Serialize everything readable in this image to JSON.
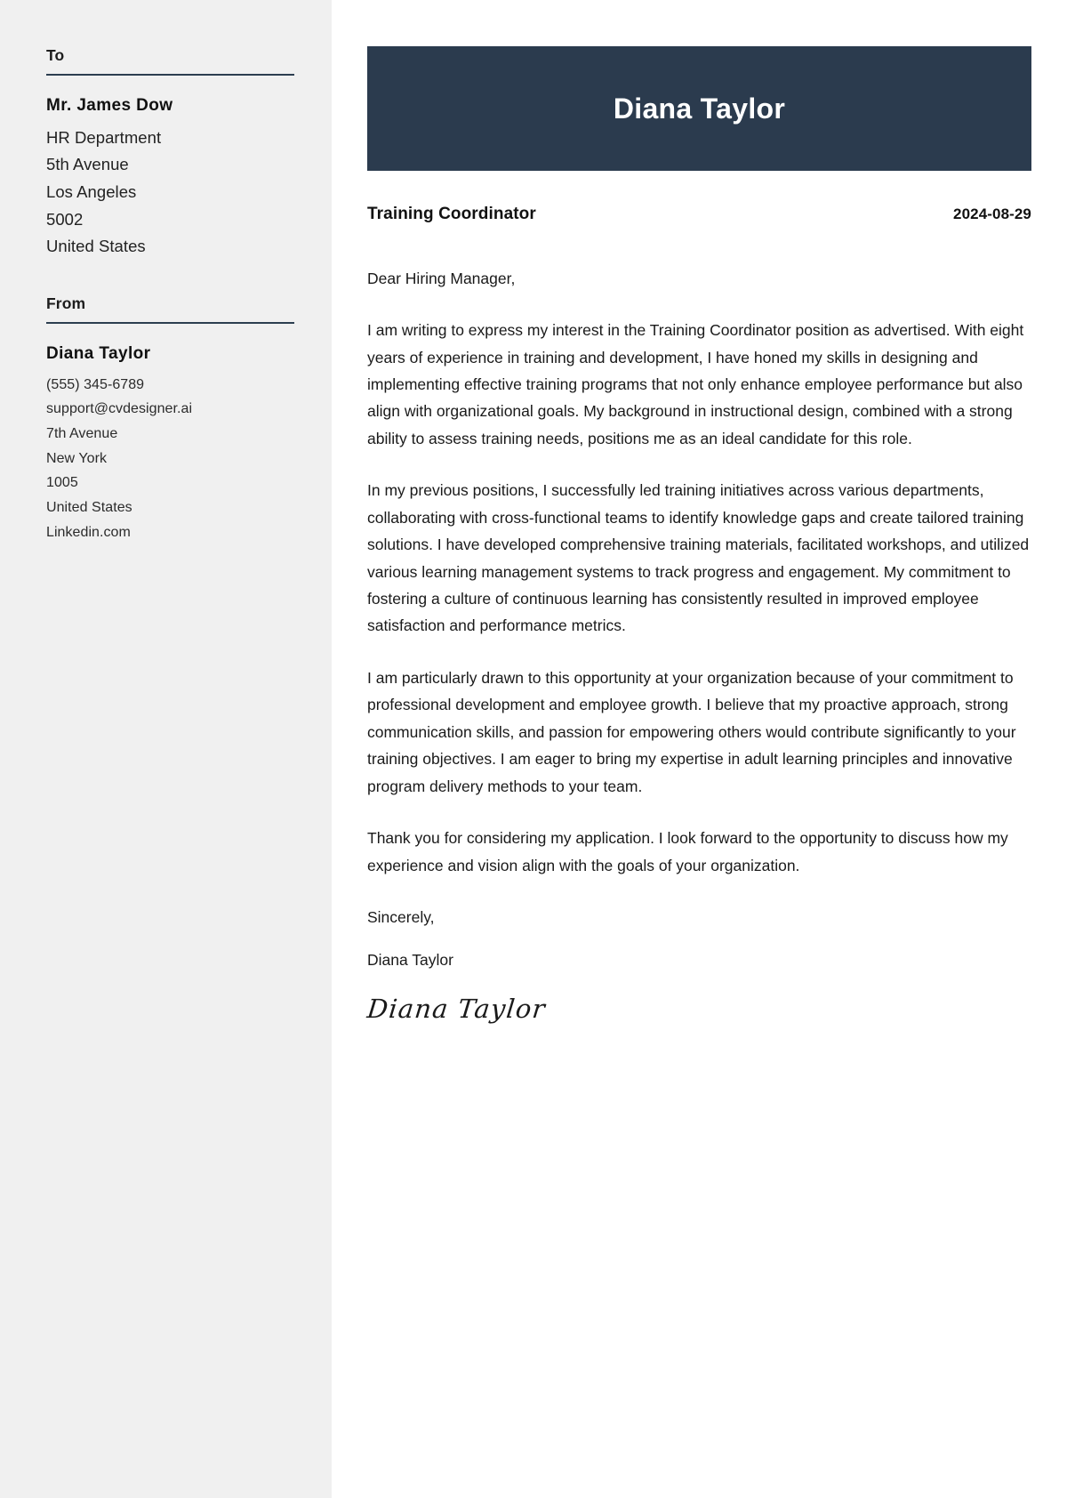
{
  "sidebar": {
    "to": {
      "heading": "To",
      "name": "Mr. James Dow",
      "lines": [
        "HR Department",
        "5th Avenue",
        "Los Angeles",
        "5002",
        "United States"
      ]
    },
    "from": {
      "heading": "From",
      "name": "Diana Taylor",
      "lines": [
        "(555) 345-6789",
        "support@cvdesigner.ai",
        "7th Avenue",
        "New York",
        "1005",
        "United States",
        "Linkedin.com"
      ]
    }
  },
  "header": {
    "name": "Diana Taylor",
    "banner_color": "#2b3b4e"
  },
  "meta": {
    "job_title": "Training Coordinator",
    "date": "2024-08-29"
  },
  "letter": {
    "salutation": "Dear Hiring Manager,",
    "paragraphs": [
      "I am writing to express my interest in the Training Coordinator position as advertised. With eight years of experience in training and development, I have honed my skills in designing and implementing effective training programs that not only enhance employee performance but also align with organizational goals. My background in instructional design, combined with a strong ability to assess training needs, positions me as an ideal candidate for this role.",
      "In my previous positions, I successfully led training initiatives across various departments, collaborating with cross-functional teams to identify knowledge gaps and create tailored training solutions. I have developed comprehensive training materials, facilitated workshops, and utilized various learning management systems to track progress and engagement. My commitment to fostering a culture of continuous learning has consistently resulted in improved employee satisfaction and performance metrics.",
      "I am particularly drawn to this opportunity at your organization because of your commitment to professional development and employee growth. I believe that my proactive approach, strong communication skills, and passion for empowering others would contribute significantly to your training objectives. I am eager to bring my expertise in adult learning principles and innovative program delivery methods to your team.",
      "Thank you for considering my application. I look forward to the opportunity to discuss how my experience and vision align with the goals of your organization."
    ],
    "closing_word": "Sincerely,",
    "closing_name": "Diana Taylor",
    "signature": "Diana Taylor"
  }
}
